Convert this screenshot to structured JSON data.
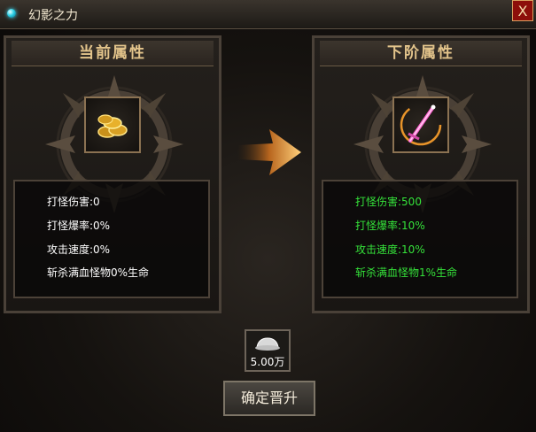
{
  "window": {
    "title": "幻影之力",
    "close_label": "X"
  },
  "current": {
    "header": "当前属性",
    "item_icon": "gold-coins-icon",
    "stats": [
      "打怪伤害:0",
      "打怪爆率:0%",
      "攻击速度:0%",
      "斩杀满血怪物0%生命"
    ]
  },
  "next": {
    "header": "下阶属性",
    "item_icon": "pink-sword-icon",
    "stats": [
      "打怪伤害:500",
      "打怪爆率:10%",
      "攻击速度:10%",
      "斩杀满血怪物1%生命"
    ]
  },
  "cost": {
    "icon": "silver-ingot-icon",
    "amount": "5.00万"
  },
  "confirm_label": "确定晋升",
  "colors": {
    "current_stat": "#ffffff",
    "next_stat": "#35e23a",
    "header_text": "#e3c48b",
    "close_bg": "#8d0f0a"
  }
}
